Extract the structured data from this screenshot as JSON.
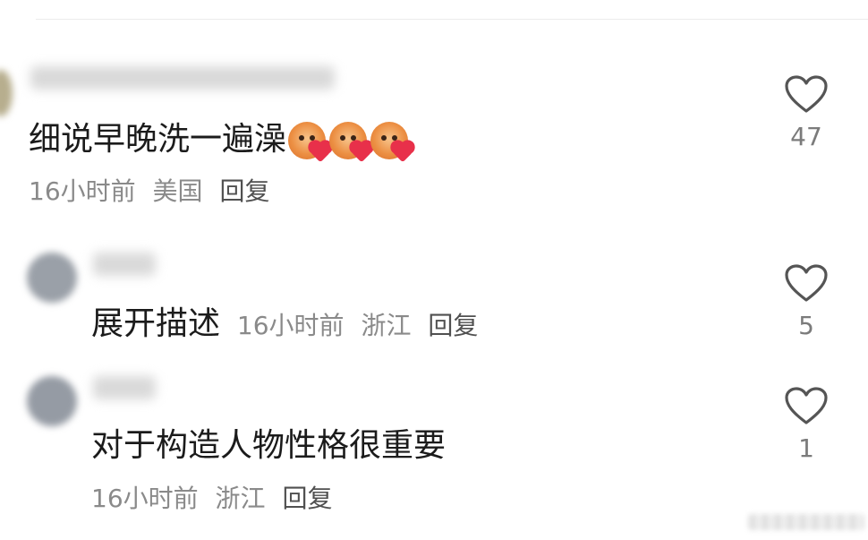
{
  "comments": [
    {
      "text": "细说早晚洗一遍澡",
      "emojis": [
        "cat-heart-emoji",
        "cat-heart-emoji",
        "cat-heart-emoji"
      ],
      "time": "16小时前",
      "location": "美国",
      "reply_label": "回复",
      "likes": "47"
    },
    {
      "text": "展开描述",
      "time": "16小时前",
      "location": "浙江",
      "reply_label": "回复",
      "likes": "5"
    },
    {
      "text": "对于构造人物性格很重要",
      "time": "16小时前",
      "location": "浙江",
      "reply_label": "回复",
      "likes": "1"
    }
  ],
  "colors": {
    "text": "#1b1b1b",
    "meta": "#8a8a8a",
    "reply": "#505050",
    "heart_outline": "#555555"
  }
}
